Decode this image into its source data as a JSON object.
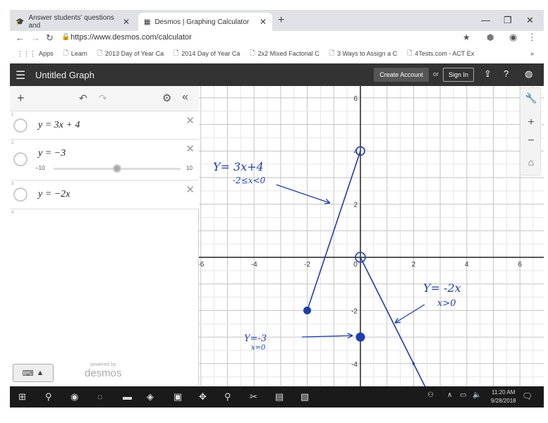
{
  "browser": {
    "tabs": [
      {
        "label": "Answer students' questions and",
        "active": false
      },
      {
        "label": "Desmos | Graphing Calculator",
        "active": true
      }
    ],
    "url": "https://www.desmos.com/calculator",
    "bookmarks": [
      {
        "label": "Apps",
        "icon": "apps-grid-icon"
      },
      {
        "label": "Learn",
        "icon": "page-icon"
      },
      {
        "label": "2013 Day of Year Ca",
        "icon": "page-icon"
      },
      {
        "label": "2014 Day of Year Ca",
        "icon": "page-icon"
      },
      {
        "label": "2x2 Mixed Factorial C",
        "icon": "page-icon"
      },
      {
        "label": "3 Ways to Assign a C",
        "icon": "page-icon"
      },
      {
        "label": "4Tests.com - ACT Ex",
        "icon": "page-icon"
      }
    ],
    "bookmarks_more": "»"
  },
  "desmos": {
    "title": "Untitled Graph",
    "create_account": "Create Account",
    "or": "or",
    "sign_in": "Sign In",
    "expressions": [
      {
        "num": "1",
        "latex": "y = 3x + 4"
      },
      {
        "num": "2",
        "latex": "y = −3",
        "slider": {
          "min": "−10",
          "max": "10",
          "value": 0.5
        }
      },
      {
        "num": "3",
        "latex": "y = −2x"
      }
    ],
    "empty_row_num": "4",
    "powered_by": "powered by",
    "brand": "desmos"
  },
  "graph": {
    "x_ticks": [
      "-6",
      "-4",
      "-2",
      "0",
      "2",
      "4",
      "6"
    ],
    "y_ticks": [
      "6",
      "4",
      "2",
      "-2",
      "-4"
    ],
    "annotations": [
      {
        "line1": "Y= 3x+4",
        "line2": "-2≤x<0"
      },
      {
        "line1": "Y= -2x",
        "line2": "x>0"
      },
      {
        "line1": "Y=-3",
        "line2": "x=0"
      }
    ],
    "ink_color": "#1f3fa8"
  },
  "taskbar": {
    "time": "11:20 AM",
    "date": "9/28/2018"
  }
}
